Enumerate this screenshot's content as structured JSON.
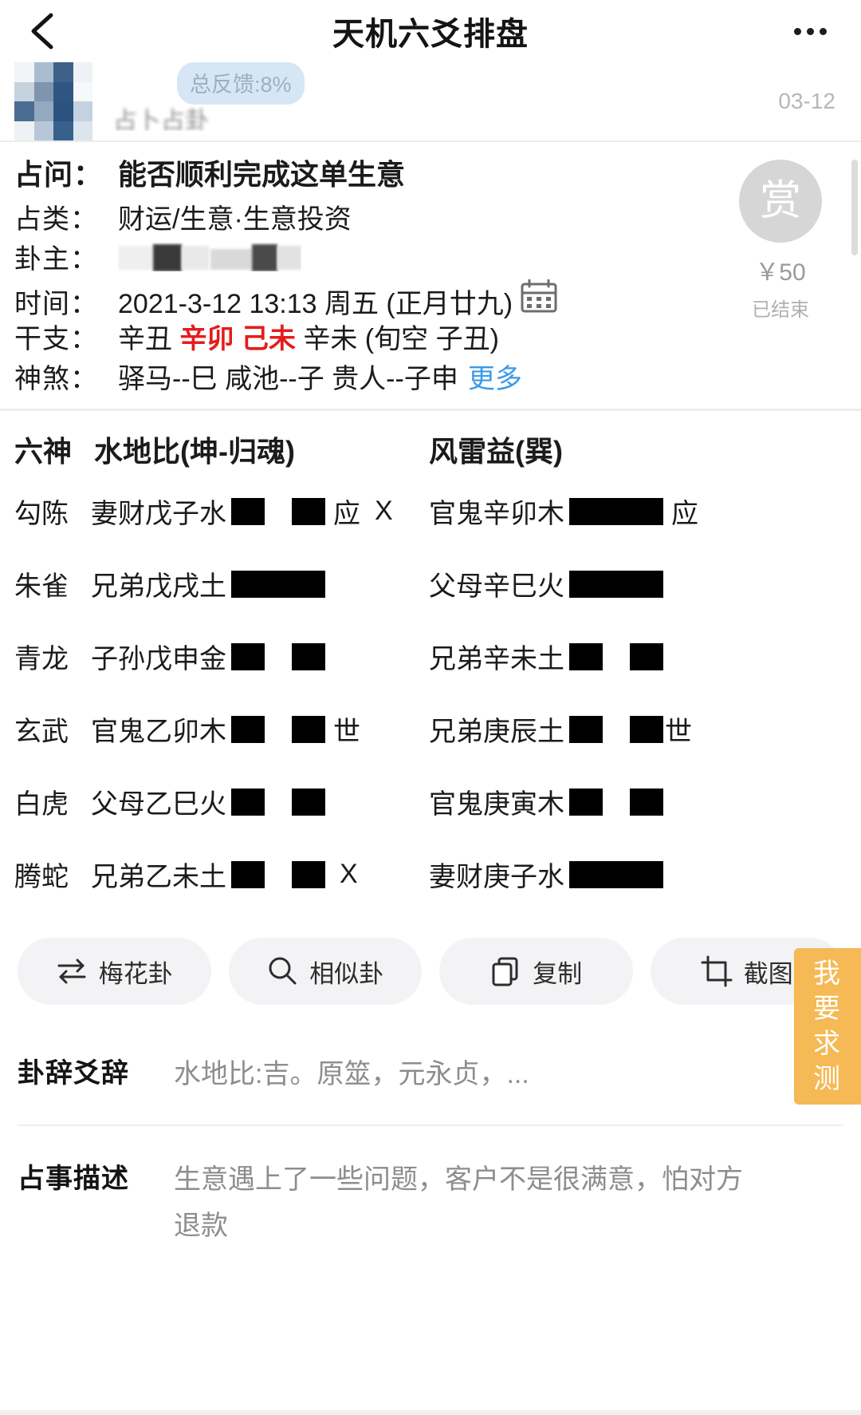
{
  "navbar": {
    "back_icon": "chevron-left-icon",
    "title": "天机六爻排盘",
    "more_icon": "ellipsis-icon"
  },
  "user": {
    "avatar": "blurred-avatar",
    "feedback_badge": "总反馈:8%",
    "username_masked": "占卜占卦",
    "date": "03-12",
    "scrollbar": "vertical-scrollbar"
  },
  "info": {
    "rows": [
      {
        "label": "占问：",
        "value": "能否顺利完成这单生意"
      },
      {
        "label": "占类：",
        "value": "财运/生意·生意投资"
      },
      {
        "label": "卦主：",
        "value": ""
      },
      {
        "label": "时间：",
        "value": "2021-3-12 13:13 周五 (正月廿九)"
      }
    ],
    "ganzhi": {
      "label": "干支：",
      "part1": "辛丑",
      "part2_red": "辛卯",
      "part3_red": "己未",
      "part4": "辛未 (旬空 子丑)"
    },
    "shensha": {
      "label": "神煞：",
      "value": "驿马--巳  咸池--子  贵人--子申",
      "more": "更多"
    },
    "calendar_icon": "calendar-icon"
  },
  "reward": {
    "badge_text": "赏",
    "price": "￥50",
    "status": "已结束"
  },
  "hexagram": {
    "col_left_label": "六神",
    "col_left_title": "水地比(坤-归魂)",
    "col_right_title": "风雷益(巽)",
    "rows": [
      {
        "six_god": "勾陈",
        "left_name": "妻财戊子水",
        "left_type": "broken",
        "left_mark": "应",
        "left_change": "X",
        "right_name": "官鬼辛卯木",
        "right_type": "solid",
        "right_mark": "应"
      },
      {
        "six_god": "朱雀",
        "left_name": "兄弟戊戌土",
        "left_type": "solid",
        "left_mark": "",
        "left_change": "",
        "right_name": "父母辛巳火",
        "right_type": "solid",
        "right_mark": ""
      },
      {
        "six_god": "青龙",
        "left_name": "子孙戊申金",
        "left_type": "broken",
        "left_mark": "",
        "left_change": "",
        "right_name": "兄弟辛未土",
        "right_type": "broken",
        "right_mark": ""
      },
      {
        "six_god": "玄武",
        "left_name": "官鬼乙卯木",
        "left_type": "broken",
        "left_mark": "世",
        "left_change": "",
        "right_name": "兄弟庚辰土",
        "right_type": "broken",
        "right_mark": "世"
      },
      {
        "six_god": "白虎",
        "left_name": "父母乙巳火",
        "left_type": "broken",
        "left_mark": "",
        "left_change": "",
        "right_name": "官鬼庚寅木",
        "right_type": "broken",
        "right_mark": ""
      },
      {
        "six_god": "腾蛇",
        "left_name": "兄弟乙未土",
        "left_type": "broken",
        "left_mark": "",
        "left_change": "X",
        "right_name": "妻财庚子水",
        "right_type": "solid",
        "right_mark": ""
      }
    ]
  },
  "actions": [
    {
      "label": "梅花卦",
      "icon": "swap-arrows-icon"
    },
    {
      "label": "相似卦",
      "icon": "search-icon"
    },
    {
      "label": "复制",
      "icon": "copy-icon"
    },
    {
      "label": "截图",
      "icon": "crop-icon"
    }
  ],
  "details": [
    {
      "label": "卦辞爻辞",
      "value": "水地比:吉。原筮，元永贞，..."
    },
    {
      "label": "占事描述",
      "value": "生意遇上了一些问题，客户不是很满意，怕对方退款"
    }
  ],
  "fab": {
    "chars": [
      "我",
      "要",
      "求",
      "测"
    ],
    "color": "#f5b955"
  },
  "colors": {
    "accent_red": "#e51c1c",
    "link_blue": "#3a9ae8",
    "badge_blue_bg": "#d7e6f5",
    "button_bg": "#f3f3f5",
    "fab_orange": "#f5b955"
  }
}
